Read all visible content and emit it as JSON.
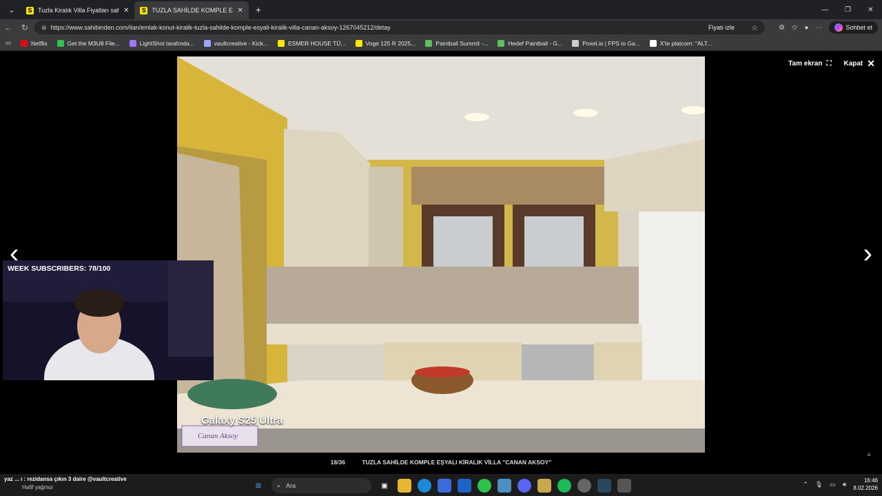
{
  "browser": {
    "tabs": [
      {
        "title": "Tuzla Kiralık Villa Fiyatları sahibinden",
        "active": false
      },
      {
        "title": "TUZLA SAHİLDE KOMPLE EŞYALI KİR",
        "active": true
      }
    ],
    "url": "https://www.sahibinden.com/ilan/emlak-konut-kiralik-tuzla-sahilde-komple-esyali-kiralik-villa-canan-aksoy-1267045212/detay",
    "price_follow": "Fiyatı izle",
    "copilot_label": "Sohbet et"
  },
  "bookmarks": [
    {
      "label": "Netflix",
      "color": "#e50914"
    },
    {
      "label": "Get the M3U8 File...",
      "color": "#31c24d"
    },
    {
      "label": "LightShot tarafında...",
      "color": "#a074ff"
    },
    {
      "label": "vaultcreative - Kick...",
      "color": "#9aa7ff"
    },
    {
      "label": "ESMER HOUSE TÜ...",
      "color": "#ffe800"
    },
    {
      "label": "Voge 125 R 2025...",
      "color": "#ffe800"
    },
    {
      "label": "Paintball Summit -...",
      "color": "#5bc25b"
    },
    {
      "label": "Hedef Paintball - G...",
      "color": "#5bc25b"
    },
    {
      "label": "Poxel.io | FPS io Ga...",
      "color": "#cccccc"
    },
    {
      "label": "X'te platcom: \"ALT...",
      "color": "#ffffff"
    }
  ],
  "viewer": {
    "fullscreen_label": "Tam ekran",
    "close_label": "Kapat",
    "counter": "18/36",
    "caption": "TUZLA SAHİLDE KOMPLE EŞYALI KİRALIK VİLLA \"CANAN AKSOY\"",
    "photo_watermark": "Galaxy S25 Ultra",
    "photo_logo": "Canan Aksoy"
  },
  "stream": {
    "subscribers": "WEEK SUBSCRIBERS: 78/100"
  },
  "taskbar": {
    "notification": "yaz ... ı : rezidansa çıkın 3 daire @vaultcreative",
    "weather": "Hafif yağmur",
    "search_placeholder": "Ara",
    "time": "16:46",
    "date": "8.02.2026"
  }
}
